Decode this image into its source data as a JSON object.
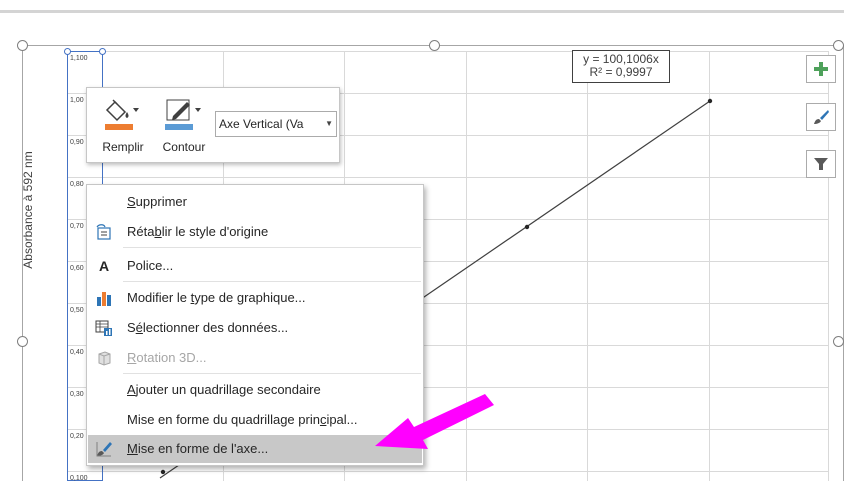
{
  "chart": {
    "y_axis_title": "Absorbance à 592 nm",
    "y_tick_labels": [
      "1,100",
      "1,00",
      "0,90",
      "0,80",
      "0,70",
      "0,60",
      "0,50",
      "0,40",
      "0,30",
      "0,20",
      "0,100"
    ],
    "trendline_equation": "y = 100,1006x",
    "trendline_r2": "R² = 0,9997"
  },
  "side_buttons": [
    {
      "icon": "plus-icon",
      "color": "#4ea15b"
    },
    {
      "icon": "brush-icon",
      "color": "#2e75b6"
    },
    {
      "icon": "filter-icon",
      "color": "#595959"
    }
  ],
  "mini_toolbar": {
    "fill_label": "Remplir",
    "outline_label": "Contour",
    "element_dropdown": "Axe Vertical (Va",
    "fill_color": "#ed7d31",
    "outline_color": "#5b9bd5"
  },
  "context_menu": {
    "items": [
      {
        "pre": "",
        "acc": "S",
        "post": "upprimer",
        "icon": ""
      },
      {
        "pre": "Réta",
        "acc": "b",
        "post": "lir le style d'origine",
        "icon": "reset-style-icon"
      },
      {
        "pre": "",
        "acc": "",
        "post": "Police...",
        "icon": "font-icon"
      },
      {
        "pre": "Modifier le ",
        "acc": "t",
        "post": "ype de graphique...",
        "icon": "chart-type-icon"
      },
      {
        "pre": "S",
        "acc": "é",
        "post": "lectionner des données...",
        "icon": "select-data-icon"
      },
      {
        "pre": "",
        "acc": "R",
        "post": "otation 3D...",
        "icon": "rotation-3d-icon"
      },
      {
        "pre": "",
        "acc": "A",
        "post": "jouter un quadrillage secondaire",
        "icon": ""
      },
      {
        "pre": "Mise en forme du quadrillage prin",
        "acc": "c",
        "post": "ipal...",
        "icon": ""
      },
      {
        "pre": "",
        "acc": "M",
        "post": "ise en forme de l'axe...",
        "icon": "format-axis-icon"
      }
    ]
  },
  "annotation": {
    "arrow_color": "#ff00ff"
  }
}
